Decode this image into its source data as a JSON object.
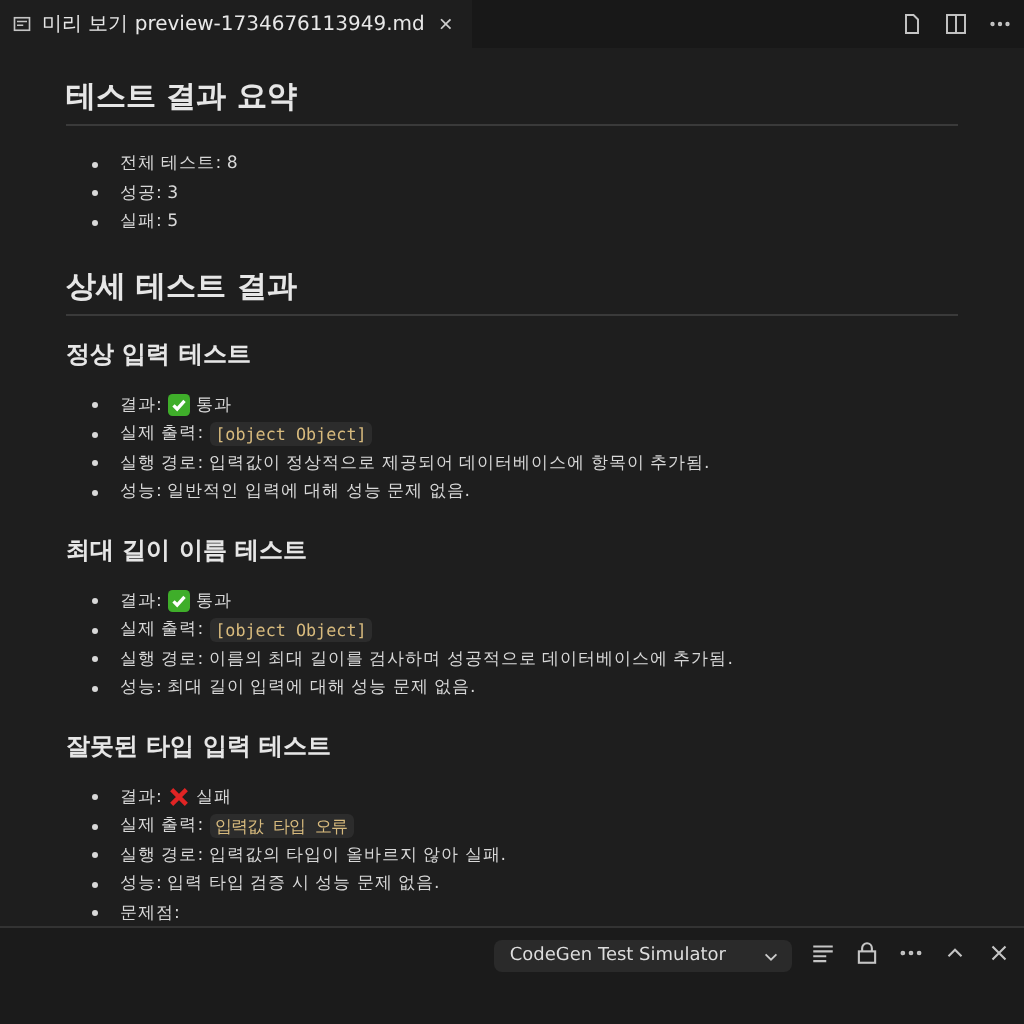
{
  "tab": {
    "title": "미리 보기 preview-1734676113949.md",
    "close": "×"
  },
  "blocks": [
    {
      "kind": "h2",
      "text": "테스트 결과 요약"
    },
    {
      "kind": "ul",
      "items": [
        {
          "text": "전체 테스트: 8"
        },
        {
          "text": "성공: 3"
        },
        {
          "text": "실패: 5"
        }
      ]
    },
    {
      "kind": "h2",
      "text": "상세 테스트 결과"
    },
    {
      "kind": "h3",
      "text": "정상 입력 테스트"
    },
    {
      "kind": "ul",
      "items": [
        {
          "label": "결과:",
          "kind": "pass",
          "text": "통과"
        },
        {
          "label": "실제 출력:",
          "code": "[object Object]"
        },
        {
          "text": "실행 경로: 입력값이 정상적으로 제공되어 데이터베이스에 항목이 추가됨."
        },
        {
          "text": "성능: 일반적인 입력에 대해 성능 문제 없음."
        }
      ]
    },
    {
      "kind": "h3",
      "text": "최대 길이 이름 테스트"
    },
    {
      "kind": "ul",
      "items": [
        {
          "label": "결과:",
          "kind": "pass",
          "text": "통과"
        },
        {
          "label": "실제 출력:",
          "code": "[object Object]"
        },
        {
          "text": "실행 경로: 이름의 최대 길이를 검사하며 성공적으로 데이터베이스에 추가됨."
        },
        {
          "text": "성능: 최대 길이 입력에 대해 성능 문제 없음."
        }
      ]
    },
    {
      "kind": "h3",
      "text": "잘못된 타입 입력 테스트"
    },
    {
      "kind": "ul",
      "items": [
        {
          "label": "결과:",
          "kind": "fail",
          "text": "실패"
        },
        {
          "label": "실제 출력:",
          "code": "입력값 타입 오류"
        },
        {
          "text": "실행 경로: 입력값의 타입이 올바르지 않아 실패."
        },
        {
          "text": "성능: 입력 타입 검증 시 성능 문제 없음."
        },
        {
          "text": "문제점:"
        }
      ]
    }
  ],
  "panel": {
    "dropdown": "CodeGen Test Simulator"
  }
}
